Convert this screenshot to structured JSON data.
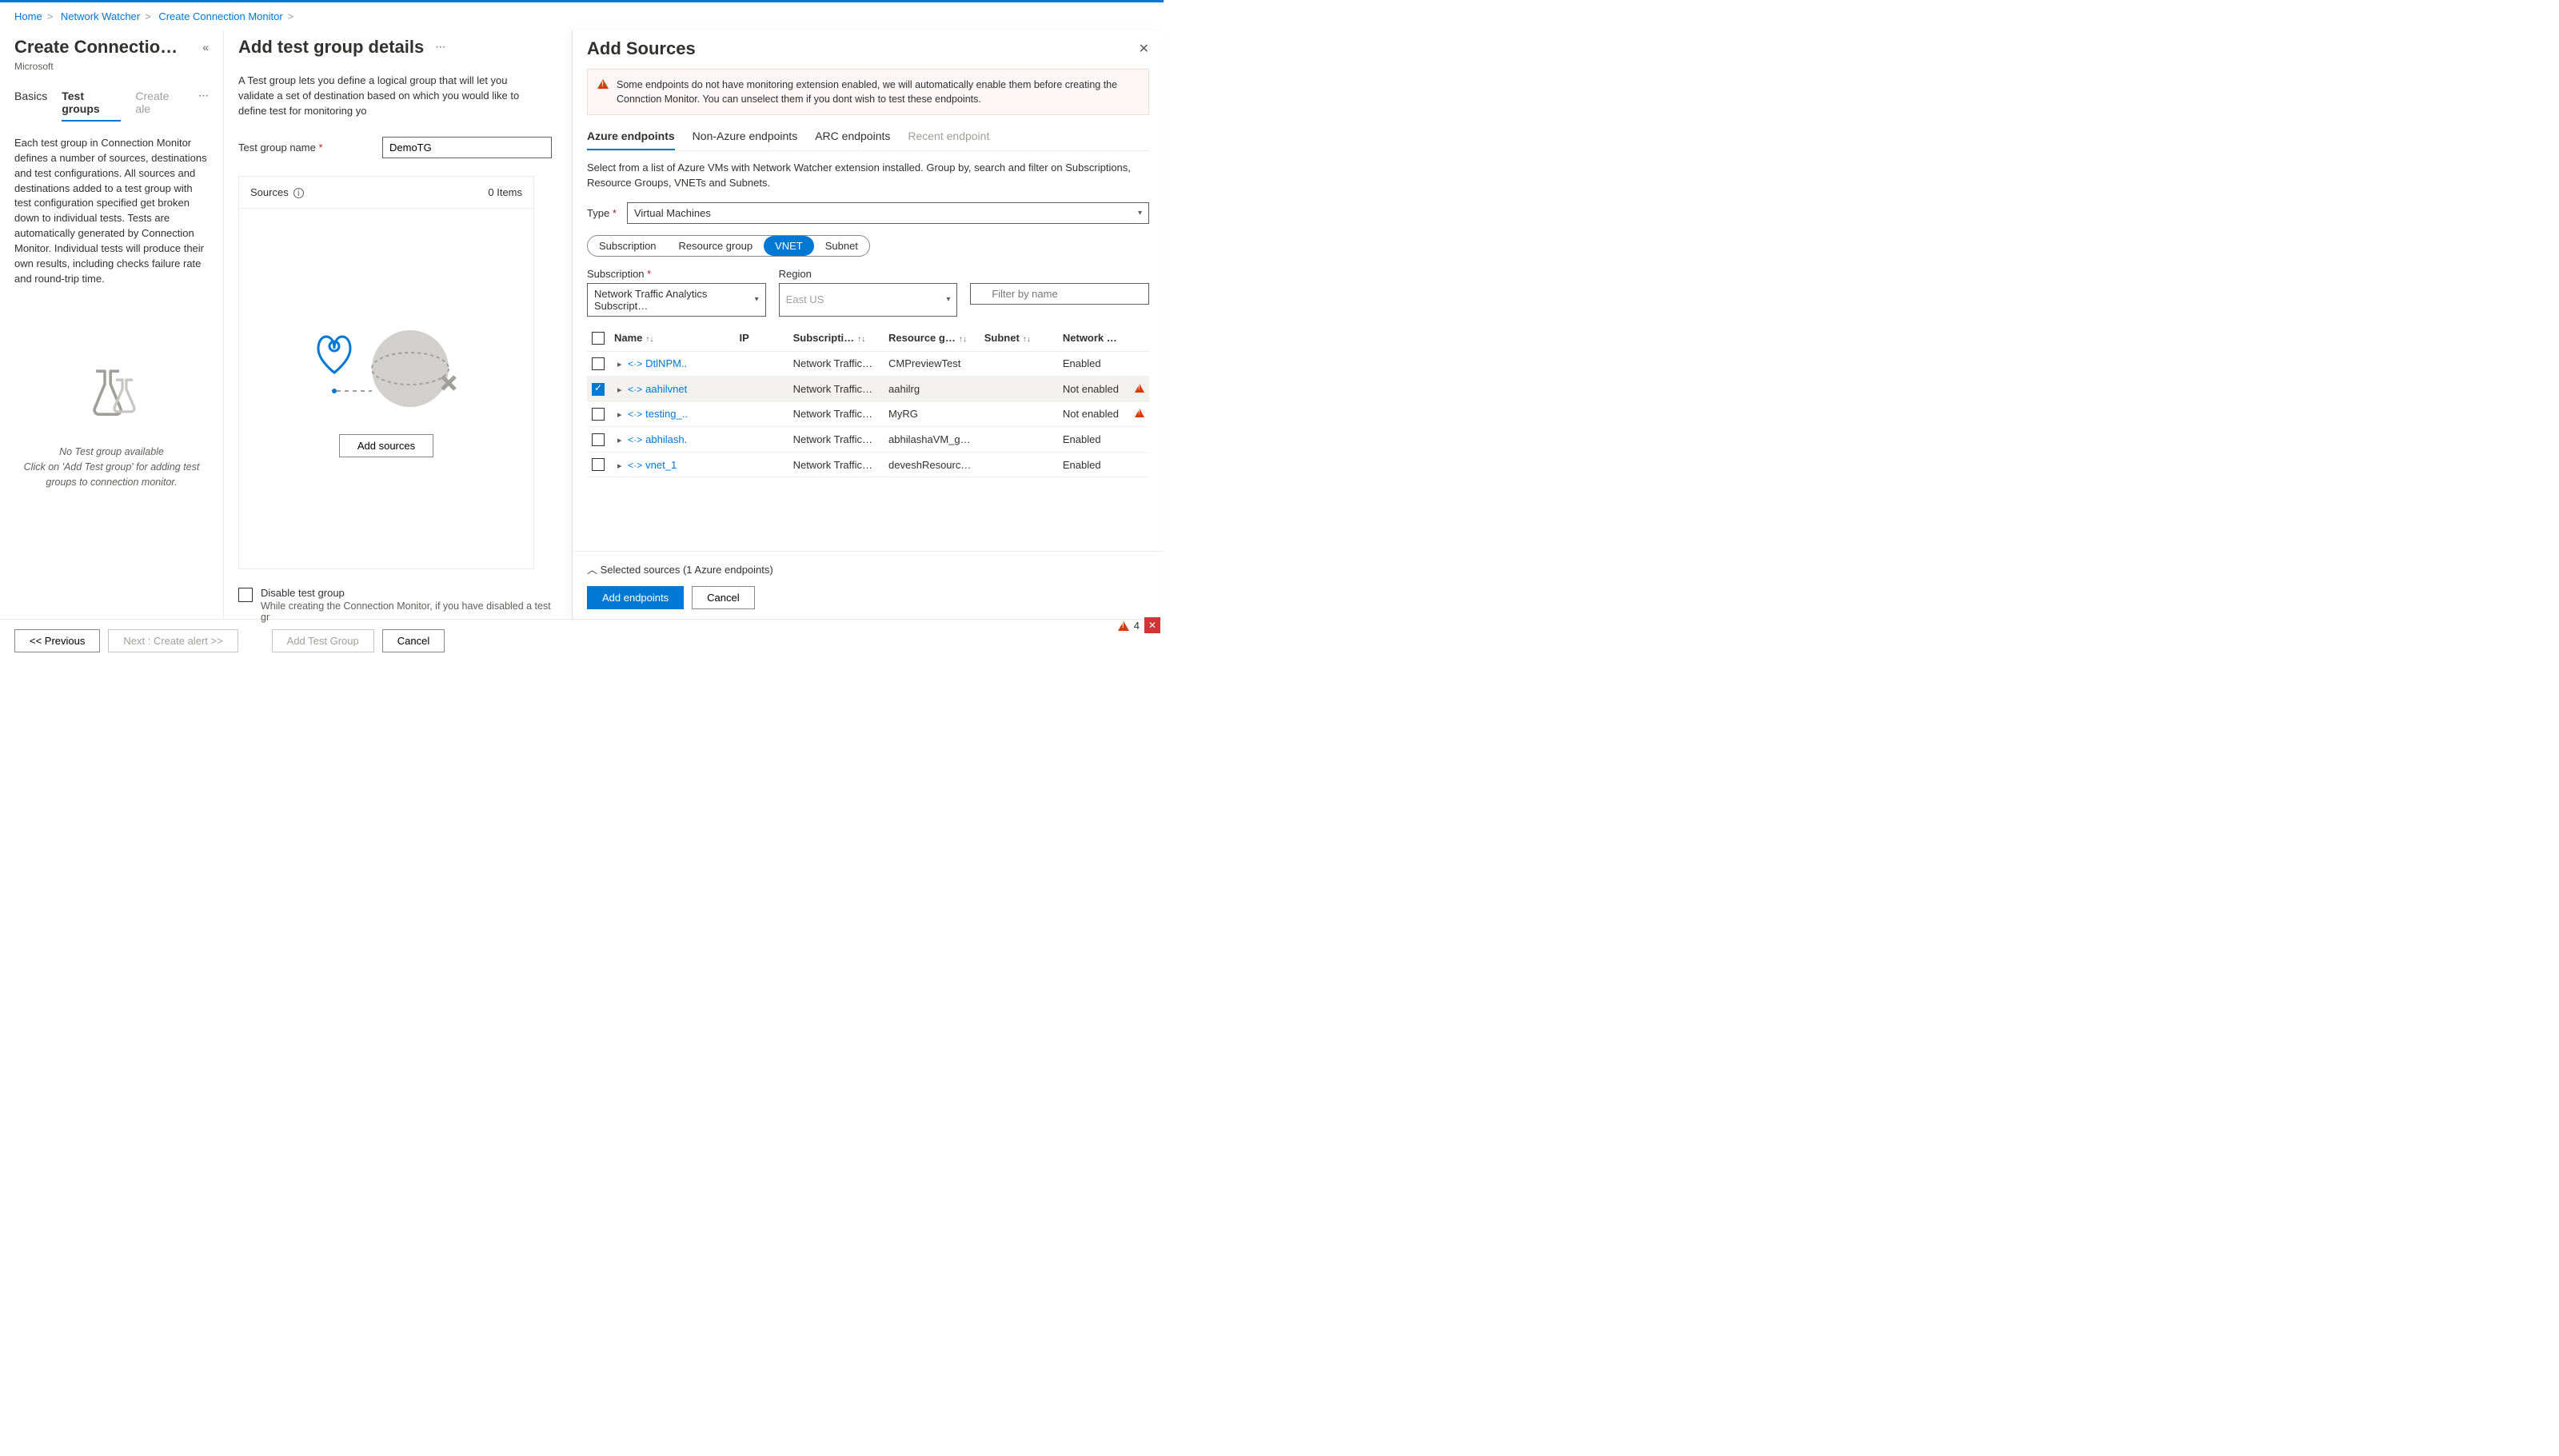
{
  "breadcrumb": {
    "home": "Home",
    "nw": "Network Watcher",
    "ccm": "Create Connection Monitor"
  },
  "left": {
    "title": "Create Connection…",
    "subtitle": "Microsoft",
    "tabs": {
      "basics": "Basics",
      "tg": "Test groups",
      "alert": "Create ale"
    },
    "desc": "Each test group in Connection Monitor defines a number of sources, destinations and test configurations. All sources and destinations added to a test group with test configuration specified get broken down to individual tests. Tests are automatically generated by Connection Monitor. Individual tests will produce their own results, including checks failure rate and round-trip time.",
    "empty_title": "No Test group available",
    "empty_sub": "Click on 'Add Test group' for adding test groups to connection monitor."
  },
  "mid": {
    "title": "Add test group details",
    "desc": "A Test group lets you define a logical group that will let you validate a set of destination based on which you would like to define test for monitoring yo",
    "tg_name_label": "Test group name",
    "tg_name_value": "DemoTG",
    "sources_label": "Sources",
    "items_count": "0 Items",
    "add_sources_btn": "Add sources",
    "disable_label": "Disable test group",
    "disable_sub": "While creating the Connection Monitor, if you have disabled a test gr"
  },
  "flyout": {
    "title": "Add Sources",
    "banner": "Some endpoints do not have monitoring extension enabled, we will automatically enable them before creating the Connction Monitor. You can unselect them if you dont wish to test these endpoints.",
    "tabs": {
      "azure": "Azure endpoints",
      "nonazure": "Non-Azure endpoints",
      "arc": "ARC endpoints",
      "recent": "Recent endpoint"
    },
    "subdesc": "Select from a list of Azure VMs with Network Watcher extension installed. Group by, search and filter on Subscriptions, Resource Groups, VNETs and Subnets.",
    "type_label": "Type",
    "type_value": "Virtual Machines",
    "pills": {
      "sub": "Subscription",
      "rg": "Resource group",
      "vnet": "VNET",
      "subnet": "Subnet"
    },
    "sub_label": "Subscription",
    "sub_value": "Network Traffic Analytics Subscript…",
    "region_label": "Region",
    "region_value": "East US",
    "filter_placeholder": "Filter by name",
    "cols": {
      "name": "Name",
      "ip": "IP",
      "sub": "Subscripti…",
      "rg": "Resource g…",
      "subnet": "Subnet",
      "nw": "Network …"
    },
    "rows": [
      {
        "name": "DtlNPM..",
        "sub": "Network Traffic…",
        "rg": "CMPreviewTest",
        "nw": "Enabled",
        "checked": false,
        "warn": false
      },
      {
        "name": "aahilvnet",
        "sub": "Network Traffic…",
        "rg": "aahilrg",
        "nw": "Not enabled",
        "checked": true,
        "warn": true
      },
      {
        "name": "testing_..",
        "sub": "Network Traffic…",
        "rg": "MyRG",
        "nw": "Not enabled",
        "checked": false,
        "warn": true
      },
      {
        "name": "abhilash.",
        "sub": "Network Traffic…",
        "rg": "abhilashaVM_g…",
        "nw": "Enabled",
        "checked": false,
        "warn": false
      },
      {
        "name": "vnet_1",
        "sub": "Network Traffic…",
        "rg": "deveshResourc…",
        "nw": "Enabled",
        "checked": false,
        "warn": false
      }
    ],
    "selected_sources": "Selected sources (1 Azure endpoints)",
    "add_btn": "Add endpoints",
    "cancel_btn": "Cancel"
  },
  "footer": {
    "prev": "<< Previous",
    "next": "Next : Create alert >>",
    "add_tg": "Add Test Group",
    "cancel": "Cancel",
    "warn_count": "4"
  }
}
